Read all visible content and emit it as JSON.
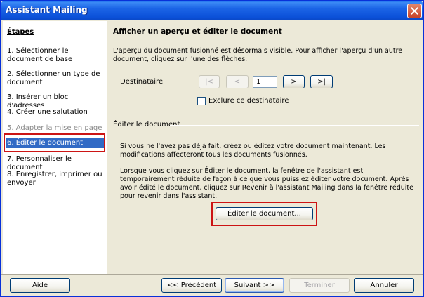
{
  "window": {
    "title": "Assistant Mailing"
  },
  "sidebar": {
    "title": "Étapes",
    "steps": [
      {
        "label": "1. Sélectionner le document de base",
        "state": "normal"
      },
      {
        "label": "2. Sélectionner un type de document",
        "state": "normal"
      },
      {
        "label": "3. Insérer un bloc d'adresses",
        "state": "normal"
      },
      {
        "label": "4. Créer une salutation",
        "state": "normal"
      },
      {
        "label": "5. Adapter la mise en page",
        "state": "disabled"
      },
      {
        "label": "6. Éditer le document",
        "state": "selected"
      },
      {
        "label": "7. Personnaliser le document",
        "state": "normal"
      },
      {
        "label": "8. Enregistrer, imprimer ou envoyer",
        "state": "normal"
      }
    ]
  },
  "main": {
    "heading": "Afficher un aperçu et éditer le document",
    "preview_text": "L'aperçu du document fusionné est désormais visible. Pour afficher l'aperçu d'un autre document, cliquez sur l'une des flèches.",
    "recipient_label": "Destinataire",
    "nav_first": "|<",
    "nav_prev": "<",
    "recipient_value": "1",
    "nav_next": ">",
    "nav_last": ">|",
    "exclude_label": "Exclure ce destinataire",
    "exclude_checked": false,
    "edit_section_label": "Éditer le document",
    "edit_text_1": "Si vous ne l'avez pas déjà fait, créez ou éditez votre document maintenant. Les modifications affecteront tous les documents fusionnés.",
    "edit_text_2": "Lorsque vous cliquez sur Éditer le document, la fenêtre de l'assistant est temporairement réduite de façon à ce que vous puissiez éditer votre document. Après avoir édité le document, cliquez sur Revenir à l'assistant Mailing dans la fenêtre réduite pour revenir dans l'assistant.",
    "edit_button": "Éditer le document..."
  },
  "footer": {
    "help": "Aide",
    "previous": "<< Précédent",
    "next": "Suivant >>",
    "finish": "Terminer",
    "cancel": "Annuler"
  },
  "colors": {
    "titlebar": "#0b50d8",
    "highlight": "#316ac5",
    "annotation_red": "#cc1414",
    "dialog_bg": "#ece9d8"
  }
}
